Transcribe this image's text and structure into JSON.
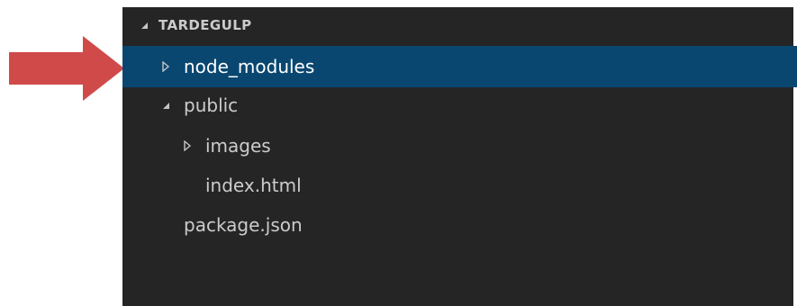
{
  "explorer": {
    "section_title": "TARDEGULP",
    "items": [
      {
        "label": "node_modules",
        "type": "folder",
        "expanded": false,
        "selected": true
      },
      {
        "label": "public",
        "type": "folder",
        "expanded": true,
        "selected": false
      },
      {
        "label": "images",
        "type": "folder",
        "expanded": false,
        "selected": false
      },
      {
        "label": "index.html",
        "type": "file",
        "selected": false
      },
      {
        "label": "package.json",
        "type": "file",
        "selected": false
      }
    ]
  },
  "annotation": {
    "arrow_color": "#d04a4a",
    "icon": "arrow-right-icon"
  },
  "colors": {
    "sidebar_background": "#252526",
    "selection_background": "#094771",
    "text": "#cccccc"
  }
}
